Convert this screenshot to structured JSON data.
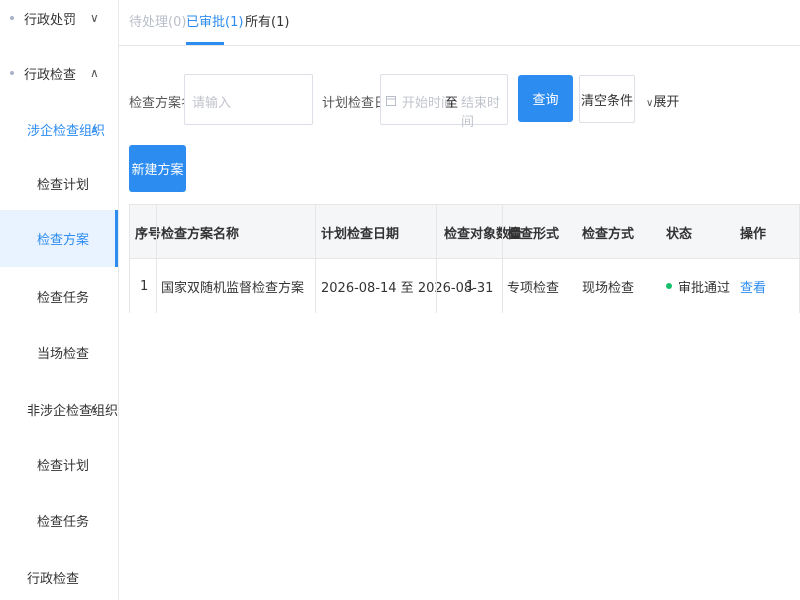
{
  "sidebar": {
    "items": [
      {
        "label": "行政处罚",
        "chevron": "∨"
      },
      {
        "label": "行政检查",
        "chevron": "∧"
      },
      {
        "label": "涉企检查组织",
        "chevron": "∧"
      },
      {
        "label": "检查计划"
      },
      {
        "label": "检查方案"
      },
      {
        "label": "检查任务"
      },
      {
        "label": "当场检查"
      },
      {
        "label": "非涉企检查组织",
        "chevron": "∧"
      },
      {
        "label": "检查计划"
      },
      {
        "label": "检查任务"
      },
      {
        "label": "行政检查"
      }
    ]
  },
  "tabs": [
    {
      "label": "待处理(0)"
    },
    {
      "label": "已审批(1)"
    },
    {
      "label": "所有(1)"
    }
  ],
  "filters": {
    "plan_name_label": "检查方案名称",
    "plan_name_placeholder": "请输入",
    "date_label": "计划检查日期",
    "start_placeholder": "开始时间",
    "separator": "至",
    "end_placeholder": "结束时间",
    "query_button": "查询",
    "clear_button": "清空条件",
    "expand_label": "展开",
    "expand_chevron": "∨"
  },
  "actions": {
    "new_plan_button": "新建方案"
  },
  "table": {
    "columns": [
      "序号",
      "检查方案名称",
      "计划检查日期",
      "检查对象数量",
      "检查形式",
      "检查方式",
      "状态",
      "操作"
    ],
    "rows": [
      {
        "index": "1",
        "name": "国家双随机监督检查方案",
        "date": "2026-08-14 至 2026-08-31",
        "count": "1",
        "form": "专项检查",
        "method": "现场检查",
        "status": "审批通过",
        "action": "查看"
      }
    ]
  },
  "colors": {
    "accent": "#2d8cf0",
    "status_ok": "#19be6b"
  }
}
